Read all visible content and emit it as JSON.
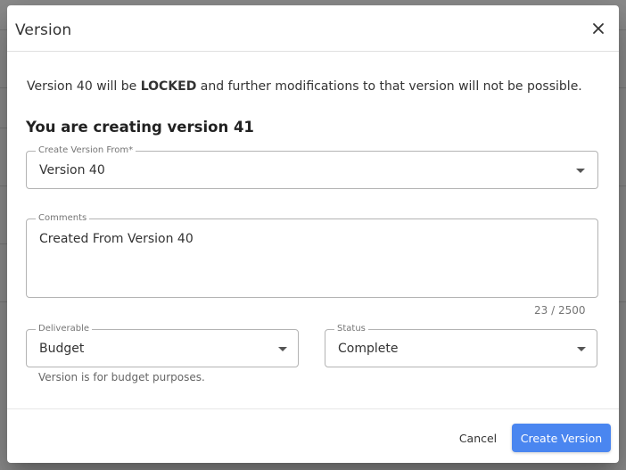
{
  "dialog": {
    "title": "Version",
    "info_prefix": "Version 40 will be ",
    "info_locked": "LOCKED",
    "info_suffix": " and further modifications to that version will not be possible.",
    "section_title": "You are creating version 41"
  },
  "form": {
    "create_from": {
      "label": "Create Version From*",
      "value": "Version 40"
    },
    "comments": {
      "label": "Comments",
      "value": "Created From Version 40",
      "counter": "23 / 2500"
    },
    "deliverable": {
      "label": "Deliverable",
      "value": "Budget",
      "helper": "Version is for budget purposes."
    },
    "status": {
      "label": "Status",
      "value": "Complete"
    }
  },
  "actions": {
    "cancel_label": "Cancel",
    "create_label": "Create Version"
  },
  "icons": {
    "close": "close-icon",
    "dropdown": "chevron-down-icon"
  },
  "colors": {
    "primary": "#4a86f0",
    "backdrop": "#8c8c8c"
  }
}
